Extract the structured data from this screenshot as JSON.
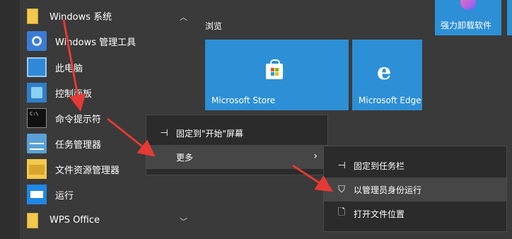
{
  "start_menu": {
    "app_list": {
      "groups": [
        {
          "label": "Windows 系统",
          "expanded": true
        },
        {
          "label": "WPS Office",
          "expanded": false
        }
      ],
      "items": [
        {
          "label": "Windows 管理工具",
          "icon": "admin-tools-icon"
        },
        {
          "label": "此电脑",
          "icon": "this-pc-icon"
        },
        {
          "label": "控制面板",
          "icon": "control-panel-icon"
        },
        {
          "label": "命令提示符",
          "icon": "command-prompt-icon"
        },
        {
          "label": "任务管理器",
          "icon": "task-manager-icon"
        },
        {
          "label": "文件资源管理器",
          "icon": "file-explorer-icon"
        },
        {
          "label": "运行",
          "icon": "run-icon"
        }
      ]
    },
    "tiles": {
      "group_label": "浏览",
      "top_tile_label": "强力卸载软件",
      "items": [
        {
          "label": "Microsoft Store",
          "icon": "store-icon"
        },
        {
          "label": "Microsoft Edge",
          "icon": "edge-icon"
        }
      ]
    },
    "context_menu": {
      "items": [
        {
          "label": "固定到\"开始\"屏幕",
          "icon": "pin-icon"
        },
        {
          "label": "更多",
          "icon": "",
          "has_submenu": true
        }
      ]
    },
    "submenu": {
      "items": [
        {
          "label": "固定到任务栏",
          "icon": "pin-icon"
        },
        {
          "label": "以管理员身份运行",
          "icon": "shield-icon",
          "highlighted": true
        },
        {
          "label": "打开文件位置",
          "icon": "file-icon"
        }
      ]
    }
  },
  "colors": {
    "menu_background": "#3a3a3a",
    "tile_blue": "#2d8fd5",
    "context_menu": "#2b2b2b",
    "highlight": "#464646",
    "annotation_arrow": "#e53935"
  }
}
